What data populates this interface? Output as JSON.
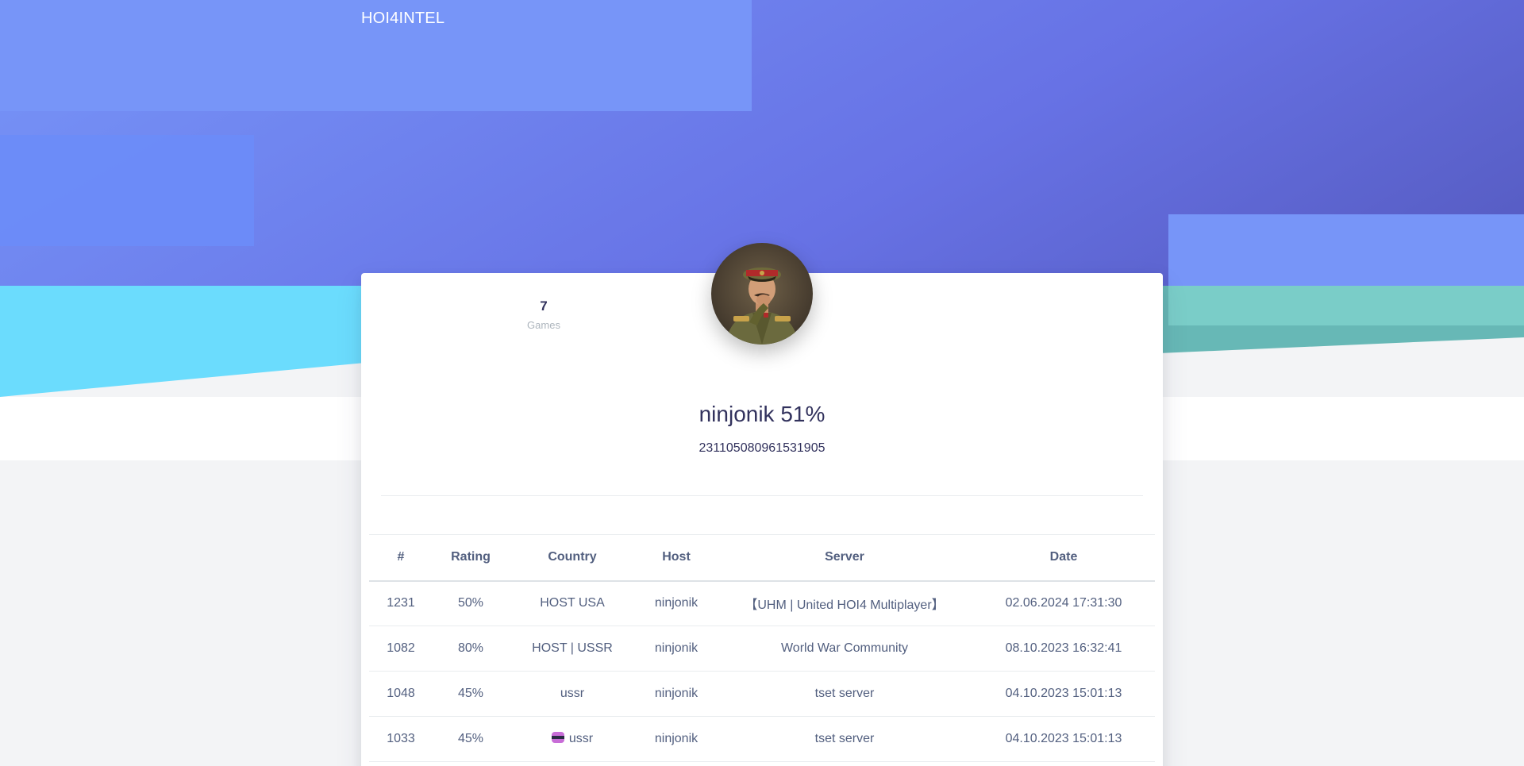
{
  "navbar": {
    "brand": "HOI4INTEL"
  },
  "profile": {
    "stats": {
      "games_value": "7",
      "games_label": "Games"
    },
    "name": "ninjonik 51%",
    "id": "231105080961531905"
  },
  "table": {
    "headers": [
      "#",
      "Rating",
      "Country",
      "Host",
      "Server",
      "Date"
    ],
    "rows": [
      {
        "num": "1231",
        "rating": "50%",
        "country": "HOST USA",
        "host": "ninjonik",
        "server": "【UHM | United HOI4 Multiplayer】",
        "date": "02.06.2024 17:31:30"
      },
      {
        "num": "1082",
        "rating": "80%",
        "country": "HOST | USSR",
        "host": "ninjonik",
        "server": "World War Community",
        "date": "08.10.2023 16:32:41"
      },
      {
        "num": "1048",
        "rating": "45%",
        "country": "ussr",
        "host": "ninjonik",
        "server": "tset server",
        "date": "04.10.2023 15:01:13"
      },
      {
        "num": "1033",
        "rating": "45%",
        "country": "ussr",
        "host": "ninjonik",
        "server": "tset server",
        "date": "04.10.2023 15:01:13"
      }
    ]
  }
}
